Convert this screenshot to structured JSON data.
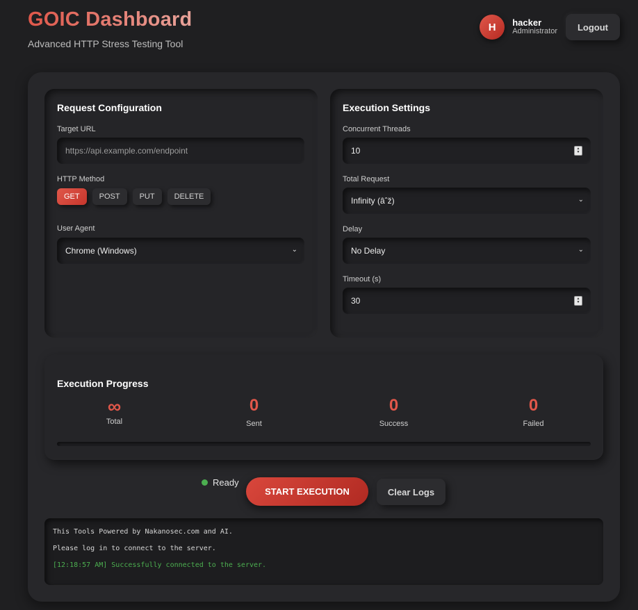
{
  "header": {
    "title": "GOIC Dashboard",
    "subtitle": "Advanced HTTP Stress Testing Tool"
  },
  "user": {
    "initial": "H",
    "name": "hacker",
    "role": "Administrator",
    "logout_label": "Logout"
  },
  "request_config": {
    "title": "Request Configuration",
    "target_url_label": "Target URL",
    "target_url_placeholder": "https://api.example.com/endpoint",
    "http_method_label": "HTTP Method",
    "methods": [
      "GET",
      "POST",
      "PUT",
      "DELETE"
    ],
    "selected_method": "GET",
    "user_agent_label": "User Agent",
    "user_agent_value": "Chrome (Windows)"
  },
  "execution_settings": {
    "title": "Execution Settings",
    "threads_label": "Concurrent Threads",
    "threads_value": "10",
    "total_request_label": "Total Request",
    "total_request_value": "Infinity (âˆž)",
    "delay_label": "Delay",
    "delay_value": "No Delay",
    "timeout_label": "Timeout (s)",
    "timeout_value": "30"
  },
  "progress": {
    "title": "Execution Progress",
    "stats": [
      {
        "value": "∞",
        "label": "Total"
      },
      {
        "value": "0",
        "label": "Sent"
      },
      {
        "value": "0",
        "label": "Success"
      },
      {
        "value": "0",
        "label": "Failed"
      }
    ],
    "percent": 0
  },
  "controls": {
    "status": "Ready",
    "start_label": "START EXECUTION",
    "clear_label": "Clear Logs"
  },
  "logs": [
    {
      "text": "This Tools Powered by Nakanosec.com and AI.",
      "type": "info"
    },
    {
      "text": "Please log in to connect to the server.",
      "type": "info"
    },
    {
      "text": "[12:18:57 AM] Successfully connected to the server.",
      "type": "success"
    }
  ],
  "colors": {
    "accent": "#e0574a",
    "status_ready": "#4caf50",
    "background": "#1f1f21"
  }
}
